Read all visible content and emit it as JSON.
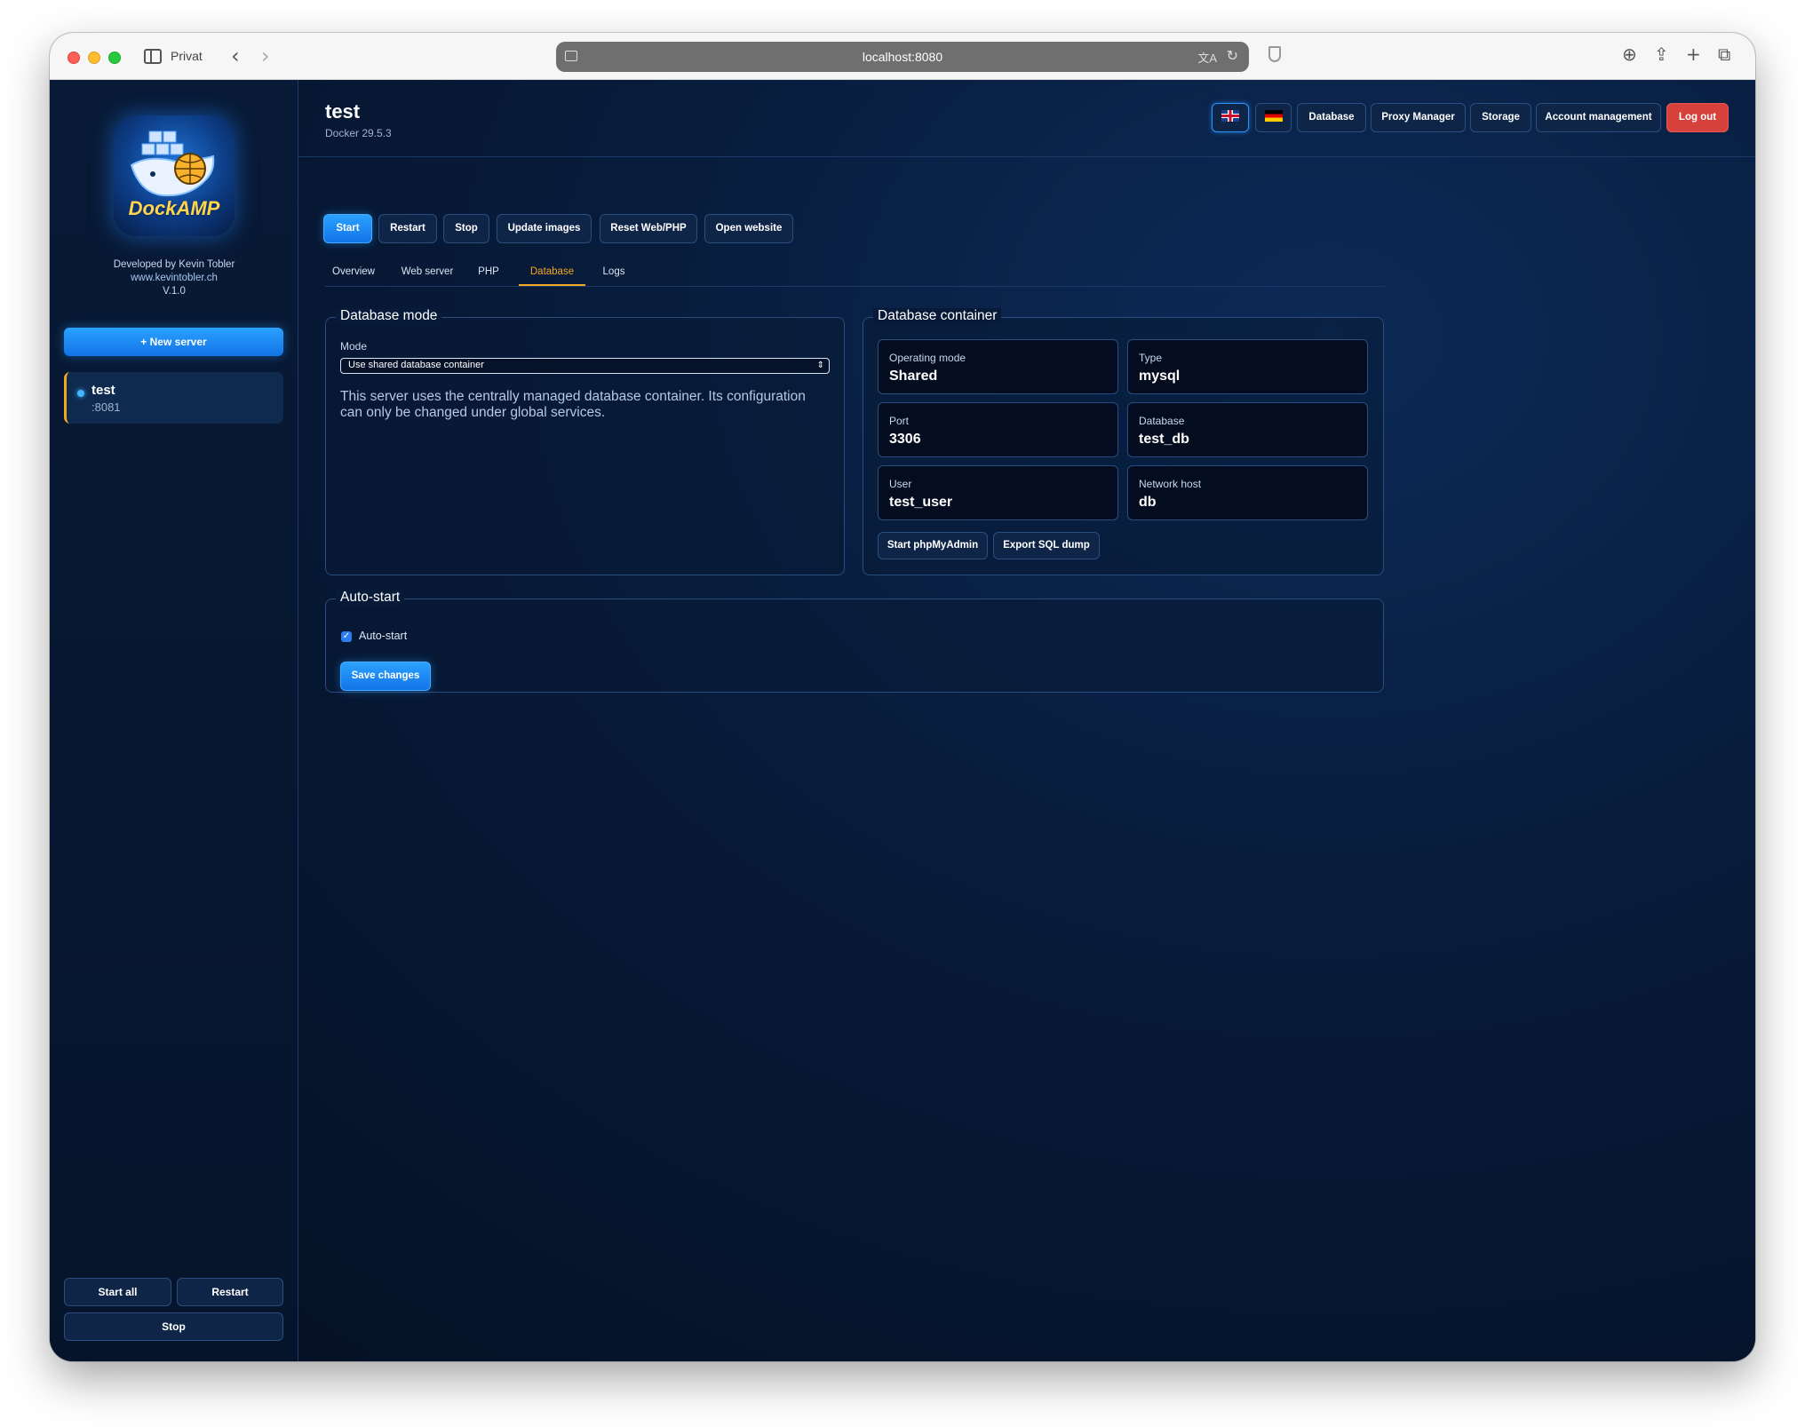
{
  "browser": {
    "profile_label": "Privat",
    "url": "localhost:8080"
  },
  "sidebar": {
    "logo_text": "DockAMP",
    "developer": "Developed by Kevin Tobler",
    "website": "www.kevintobler.ch",
    "version": "V.1.0",
    "new_server_label": "+ New server",
    "servers": [
      {
        "name": "test",
        "port": ":8081",
        "status_color": "#3fb6ff"
      }
    ],
    "start_all_label": "Start all",
    "restart_label": "Restart",
    "stop_label": "Stop"
  },
  "header": {
    "title": "test",
    "subtitle": "Docker 29.5.3",
    "lang_en_icon": "uk-flag-icon",
    "lang_de_icon": "german-flag-icon",
    "database_label": "Database",
    "proxy_manager_label": "Proxy Manager",
    "storage_label": "Storage",
    "account_label": "Account management",
    "logout_label": "Log out"
  },
  "actions": {
    "start": "Start",
    "restart": "Restart",
    "stop": "Stop",
    "update_images": "Update images",
    "reset_web_php": "Reset Web/PHP",
    "open_website": "Open website"
  },
  "tabs": [
    {
      "label": "Overview",
      "active": false
    },
    {
      "label": "Web server",
      "active": false
    },
    {
      "label": "PHP",
      "active": false
    },
    {
      "label": "Database",
      "active": true
    },
    {
      "label": "Logs",
      "active": false
    }
  ],
  "database_mode": {
    "legend": "Database mode",
    "mode_label": "Mode",
    "mode_value": "Use shared database container",
    "description": "This server uses the centrally managed database container. Its configuration can only be changed under global services."
  },
  "database_container": {
    "legend": "Database container",
    "fields": [
      {
        "label": "Operating mode",
        "value": "Shared"
      },
      {
        "label": "Type",
        "value": "mysql"
      },
      {
        "label": "Port",
        "value": "3306"
      },
      {
        "label": "Database",
        "value": "test_db"
      },
      {
        "label": "User",
        "value": "test_user"
      },
      {
        "label": "Network host",
        "value": "db"
      }
    ],
    "phpmyadmin_label": "Start phpMyAdmin",
    "export_label": "Export SQL dump"
  },
  "autostart": {
    "legend": "Auto-start",
    "checkbox_label": "Auto-start",
    "checked": true,
    "save_label": "Save changes"
  },
  "colors": {
    "accent": "#1f8bff",
    "active_tab": "#f5a623",
    "logout": "#d6413c",
    "background": "#071a38"
  }
}
